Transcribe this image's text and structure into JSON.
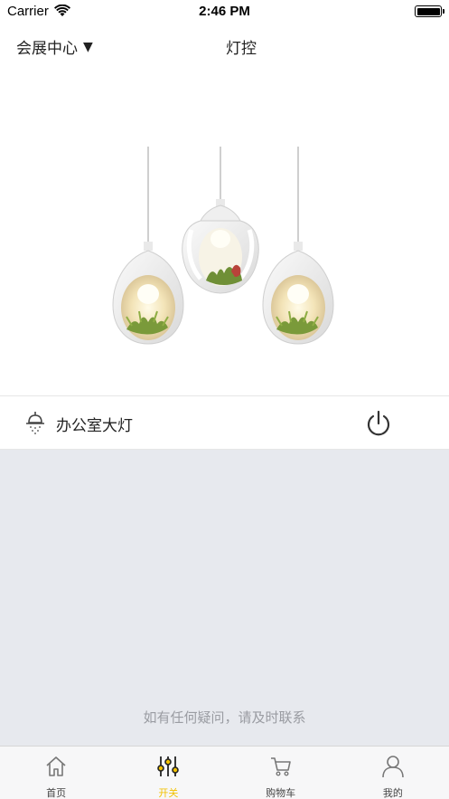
{
  "status_bar": {
    "carrier": "Carrier",
    "time": "2:46 PM"
  },
  "nav": {
    "venue": "会展中心",
    "venue_arrow": "▼",
    "title": "灯控"
  },
  "hero": {
    "image_icon": "pendant-lamps-image"
  },
  "device": {
    "name": "办公室大灯",
    "icon": "ceiling-lamp-icon",
    "power_icon": "power-icon"
  },
  "content": {
    "contact_note": "如有任何疑问，请及时联系"
  },
  "tabs": [
    {
      "label": "首页",
      "icon": "home-icon",
      "active": false
    },
    {
      "label": "开关",
      "icon": "sliders-icon",
      "active": true
    },
    {
      "label": "购物车",
      "icon": "cart-icon",
      "active": false
    },
    {
      "label": "我的",
      "icon": "user-icon",
      "active": false
    }
  ],
  "colors": {
    "accent": "#f2c200",
    "content_bg": "#e7e9ee",
    "tab_inactive": "#444444"
  }
}
